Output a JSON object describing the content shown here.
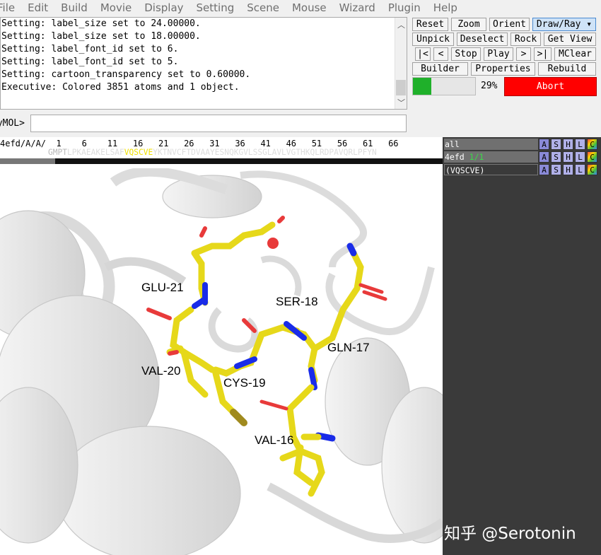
{
  "menu": [
    "File",
    "Edit",
    "Build",
    "Movie",
    "Display",
    "Setting",
    "Scene",
    "Mouse",
    "Wizard",
    "Plugin",
    "Help"
  ],
  "log_lines": [
    "Setting: label_size set to 24.00000.",
    "Setting: label_size set to 18.00000.",
    "Setting: label_font_id set to 6.",
    "Setting: label_font_id set to 5.",
    "Setting: cartoon_transparency set to 0.60000.",
    "Executive: Colored 3851 atoms and 1 object."
  ],
  "command": {
    "prompt": "PyMOL>",
    "value": ""
  },
  "buttons": {
    "row1": [
      "Reset",
      "Zoom",
      "Orient",
      "Draw/Ray ▾"
    ],
    "row2": [
      "Unpick",
      "Deselect",
      "Rock",
      "Get View"
    ],
    "row3": [
      "|<",
      "<",
      "Stop",
      "Play",
      ">",
      ">|",
      "MClear"
    ],
    "row4": [
      "Builder",
      "Properties",
      "Rebuild"
    ]
  },
  "progress": {
    "percent": 29,
    "label": "29%"
  },
  "abort_label": "Abort",
  "sequence": {
    "numbers": "4efd/A/A/  1    6    11   16   21   26   31   36   41   46   51   56   61   66",
    "pre": "GMPT",
    "dim_pre": "LPKAEAKELSAF",
    "selected": "VQSCVE",
    "post": "YKTNVCFTDVAAYESNQKGVLSSGLAVLVGTHKQLRDPAVQRLPFYN"
  },
  "objects": [
    {
      "name": "all",
      "sub": "",
      "buttons": [
        "A",
        "S",
        "H",
        "L",
        "C"
      ]
    },
    {
      "name": "4efd",
      "sub": "1/1",
      "buttons": [
        "A",
        "S",
        "H",
        "L",
        "C"
      ]
    },
    {
      "name": "(VQSCVE)",
      "sub": "",
      "buttons": [
        "A",
        "S",
        "H",
        "L",
        "C"
      ]
    }
  ],
  "residue_labels": [
    "GLU-21",
    "SER-18",
    "GLN-17",
    "VAL-20",
    "CYS-19",
    "VAL-16"
  ],
  "watermark": "知乎 @Serotonin",
  "colors": {
    "carbon": "#e6d81a",
    "nitrogen": "#1a2ce8",
    "oxygen": "#e83a3a",
    "sulfur": "#a08a1e",
    "abort": "#ff0000",
    "progress": "#1fb02a"
  }
}
